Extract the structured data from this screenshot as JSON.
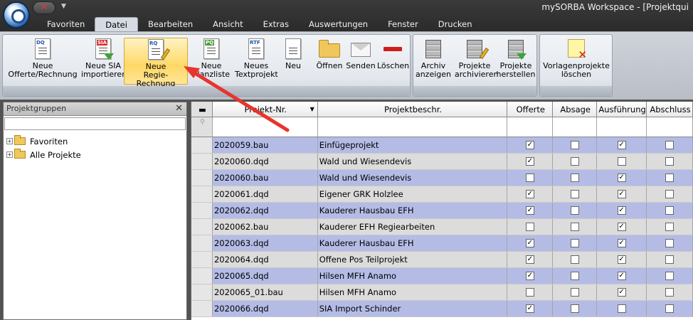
{
  "window_title": "mySORBA Workspace - [Projektqui",
  "menu_tabs": [
    "Favoriten",
    "Datei",
    "Bearbeiten",
    "Ansicht",
    "Extras",
    "Auswertungen",
    "Fenster",
    "Drucken"
  ],
  "active_tab": "Datei",
  "ribbon": {
    "neue_offerte": "Neue\nOfferte/Rechnung",
    "neue_sia": "Neue SIA\nimportieren",
    "neue_regie": "Neue\nRegie-Rechnung",
    "neue_planzliste": "Neue\nPlanzliste",
    "neues_textprojekt": "Neues\nTextprojekt",
    "neu": "Neu",
    "oeffnen": "Öffnen",
    "senden": "Senden",
    "loeschen": "Löschen",
    "archiv_anzeigen": "Archiv\nanzeigen",
    "projekte_archivieren": "Projekte\narchivieren",
    "projekte_herstellen": "Projekte\nherstellen",
    "vorlagenprojekte_loeschen": "Vorlagenprojekte\nlöschen",
    "icon_tags": {
      "dq": "DQ",
      "sia": "SIA",
      "rq": "RQ",
      "pq": "PQ",
      "rtf": "RTF"
    }
  },
  "left_panel": {
    "title": "Projektgruppen",
    "tree": [
      {
        "label": "Favoriten",
        "expander": "+"
      },
      {
        "label": "Alle Projekte",
        "expander": "+"
      }
    ]
  },
  "grid": {
    "columns": [
      "Projekt-Nr.",
      "Projektbeschr.",
      "Offerte",
      "Absage",
      "Ausführung",
      "Abschluss"
    ],
    "rows": [
      {
        "nr": "2020059.bau",
        "desc": "Einfügeprojekt",
        "offerte": true,
        "absage": false,
        "ausfuehrung": true,
        "abschluss": false
      },
      {
        "nr": "2020060.dqd",
        "desc": "Wald und Wiesendevis",
        "offerte": true,
        "absage": false,
        "ausfuehrung": false,
        "abschluss": false
      },
      {
        "nr": "2020060.bau",
        "desc": "Wald und Wiesendevis",
        "offerte": false,
        "absage": false,
        "ausfuehrung": true,
        "abschluss": false
      },
      {
        "nr": "2020061.dqd",
        "desc": "Eigener GRK Holzlee",
        "offerte": true,
        "absage": false,
        "ausfuehrung": true,
        "abschluss": false
      },
      {
        "nr": "2020062.dqd",
        "desc": "Kauderer Hausbau EFH",
        "offerte": true,
        "absage": false,
        "ausfuehrung": true,
        "abschluss": false
      },
      {
        "nr": "2020062.bau",
        "desc": "Kauderer EFH Regiearbeiten",
        "offerte": false,
        "absage": false,
        "ausfuehrung": true,
        "abschluss": false
      },
      {
        "nr": "2020063.dqd",
        "desc": "Kauderer Hausbau EFH",
        "offerte": true,
        "absage": false,
        "ausfuehrung": true,
        "abschluss": false
      },
      {
        "nr": "2020064.dqd",
        "desc": "Offene Pos Teilprojekt",
        "offerte": true,
        "absage": false,
        "ausfuehrung": true,
        "abschluss": false
      },
      {
        "nr": "2020065.dqd",
        "desc": "Hilsen MFH Anamo",
        "offerte": true,
        "absage": false,
        "ausfuehrung": true,
        "abschluss": false
      },
      {
        "nr": "2020065_01.bau",
        "desc": "Hilsen MFH Anamo",
        "offerte": false,
        "absage": false,
        "ausfuehrung": true,
        "abschluss": false
      },
      {
        "nr": "2020066.dqd",
        "desc": "SIA Import Schinder",
        "offerte": true,
        "absage": false,
        "ausfuehrung": false,
        "abschluss": false
      }
    ]
  },
  "colors": {
    "row_blue": "#b4bce6",
    "row_grey": "#dcdcdc",
    "annotation_arrow": "#e8342c"
  }
}
